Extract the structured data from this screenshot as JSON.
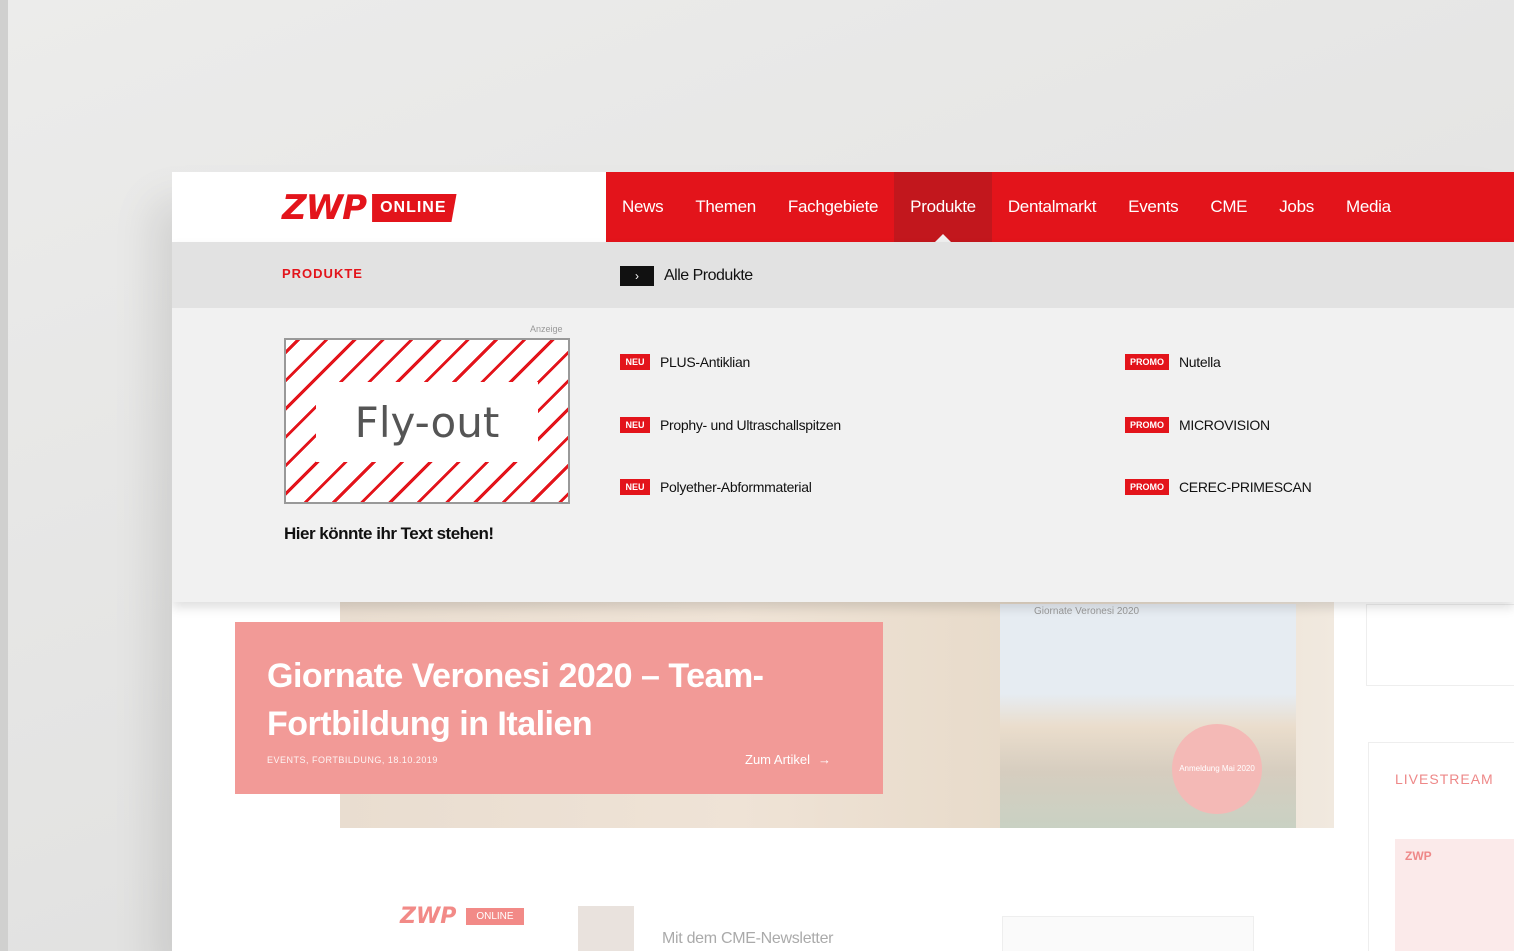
{
  "header": {
    "logo": {
      "main": "ZWP",
      "badge": "ONLINE"
    },
    "nav": [
      "News",
      "Themen",
      "Fachgebiete",
      "Produkte",
      "Dentalmarkt",
      "Events",
      "CME",
      "Jobs",
      "Media"
    ],
    "active_nav": "Produkte"
  },
  "flyout": {
    "title": "PRODUKTE",
    "all_products_label": "Alle Produkte",
    "ad_label": "Anzeige",
    "ad_text": "Fly-out",
    "ad_caption": "Hier könnte ihr Text stehen!",
    "products_left": [
      {
        "badge": "NEU",
        "label": "PLUS-Antiklian"
      },
      {
        "badge": "NEU",
        "label": "Prophy- und Ultraschallspitzen"
      },
      {
        "badge": "NEU",
        "label": "Polyether-Abformmaterial"
      }
    ],
    "products_right": [
      {
        "badge": "PROMO",
        "label": "Nutella"
      },
      {
        "badge": "PROMO",
        "label": "MICROVISION"
      },
      {
        "badge": "PROMO",
        "label": "CEREC-PRIMESCAN"
      }
    ]
  },
  "hero": {
    "title": "Giornate Veronesi 2020 – Team-Fortbildung in Italien",
    "meta": "EVENTS, FORTBILDUNG, 18.10.2019",
    "link": "Zum Artikel",
    "photo_label": "Giornate Veronesi 2020",
    "circle_text": "Anmeldung Mai 2020"
  },
  "sidebar": {
    "title": "LIVESTREAM",
    "card_logo": "ZWP"
  },
  "newsletter": {
    "logo": "ZWP",
    "chip": "ONLINE",
    "text": "Mit dem CME-Newsletter"
  },
  "colors": {
    "brand": "#e3141b",
    "active_nav": "#c2171d",
    "teaser": "#f29a97"
  }
}
